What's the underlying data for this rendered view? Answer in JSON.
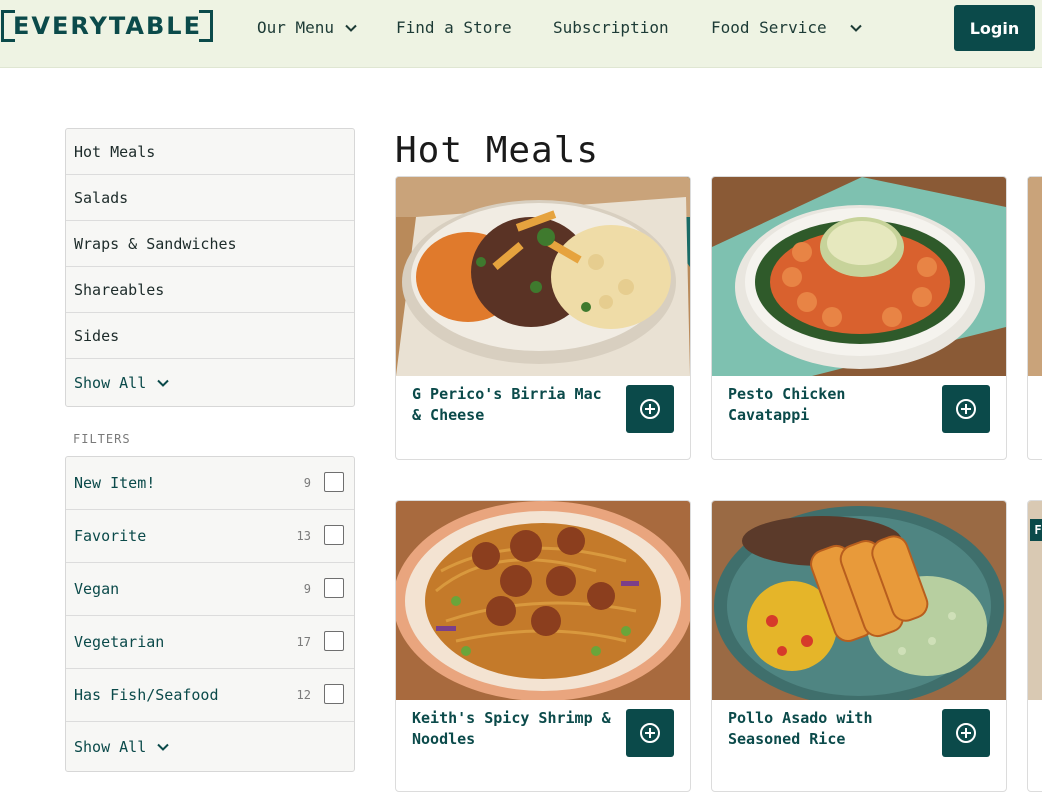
{
  "brand": {
    "logo_text": "EVERYTABLE"
  },
  "nav": {
    "items": [
      {
        "label": "Our Menu",
        "has_dropdown": true
      },
      {
        "label": "Find a Store",
        "has_dropdown": false
      },
      {
        "label": "Subscription",
        "has_dropdown": false
      },
      {
        "label": "Food Service",
        "has_dropdown": true
      }
    ],
    "login_label": "Login"
  },
  "sidebar": {
    "categories": [
      "Hot Meals",
      "Salads",
      "Wraps & Sandwiches",
      "Shareables",
      "Sides"
    ],
    "show_all_label": "Show All",
    "filters_heading": "FILTERS",
    "filters": [
      {
        "label": "New Item!",
        "count": "9"
      },
      {
        "label": "Favorite",
        "count": "13"
      },
      {
        "label": "Vegan",
        "count": "9"
      },
      {
        "label": "Vegetarian",
        "count": "17"
      },
      {
        "label": "Has Fish/Seafood",
        "count": "12"
      }
    ],
    "filters_show_all_label": "Show All"
  },
  "main": {
    "title": "Hot Meals",
    "products": [
      {
        "name": "G Perico's Birria Mac & Cheese",
        "image": "bowl-birria-mac-icon"
      },
      {
        "name": "Pesto Chicken Cavatappi",
        "image": "plate-pesto-pasta-icon"
      },
      {
        "name": "Keith's Spicy Shrimp & Noodles",
        "image": "plate-shrimp-noodles-icon"
      },
      {
        "name": "Pollo Asado with Seasoned Rice",
        "image": "plate-pollo-asado-icon"
      }
    ],
    "partial_badge": "F"
  },
  "colors": {
    "brand": "#0b4a4a",
    "header_bg": "#eef3e3",
    "sidebar_bg": "#f7f7f5"
  }
}
